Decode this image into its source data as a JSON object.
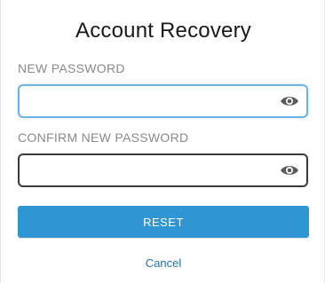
{
  "dialog": {
    "title": "Account Recovery"
  },
  "new_password": {
    "label": "NEW PASSWORD",
    "value": "",
    "placeholder": "",
    "toggle_icon": "eye-icon"
  },
  "confirm_password": {
    "label": "CONFIRM NEW PASSWORD",
    "value": "",
    "placeholder": "",
    "toggle_icon": "eye-icon"
  },
  "actions": {
    "reset_label": "RESET",
    "cancel_label": "Cancel"
  },
  "colors": {
    "primary_button": "#2f96d3",
    "link": "#2273b8",
    "focus_border": "#6cb4e8",
    "label_gray": "#8a8a8a"
  }
}
